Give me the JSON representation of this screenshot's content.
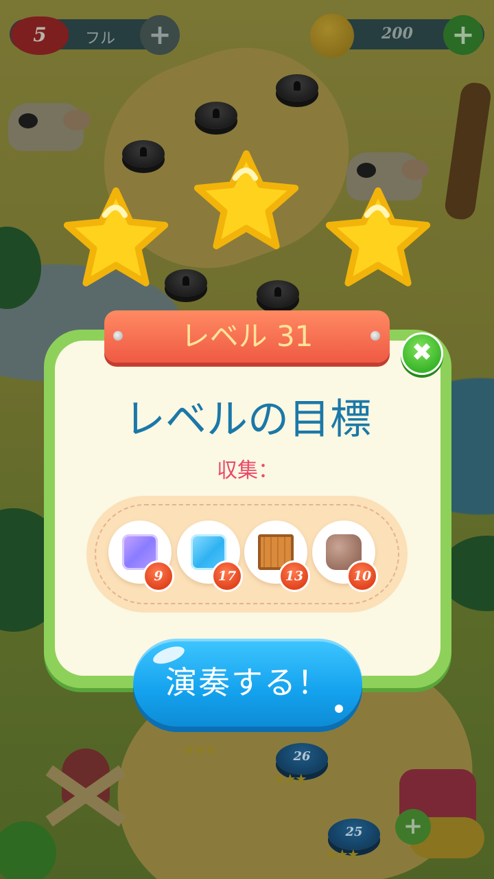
{
  "hud": {
    "lives": "5",
    "lives_status": "フル",
    "coins": "200"
  },
  "stars_earned": 3,
  "dialog": {
    "level_title": "レベル 31",
    "goal_title": "レベルの目標",
    "collect_label": "収集：",
    "items": [
      {
        "name": "purple-jelly",
        "count": "9"
      },
      {
        "name": "blue-ice",
        "count": "17"
      },
      {
        "name": "wooden-crate",
        "count": "13"
      },
      {
        "name": "cookie-block",
        "count": "10"
      }
    ],
    "play_label": "演奏する！",
    "close_icon": "close-icon"
  },
  "map": {
    "level_nodes": [
      "26",
      "25"
    ]
  },
  "colors": {
    "panel_border": "#8ed15a",
    "panel_fill": "#fbf8e3",
    "ribbon": "#ef5a44",
    "goal_title": "#1b78a8",
    "collect_label": "#e8496a",
    "play_button": "#14a2ee",
    "badge": "#e2441e",
    "close_button": "#3ab52a",
    "star": "#ffd21e"
  }
}
